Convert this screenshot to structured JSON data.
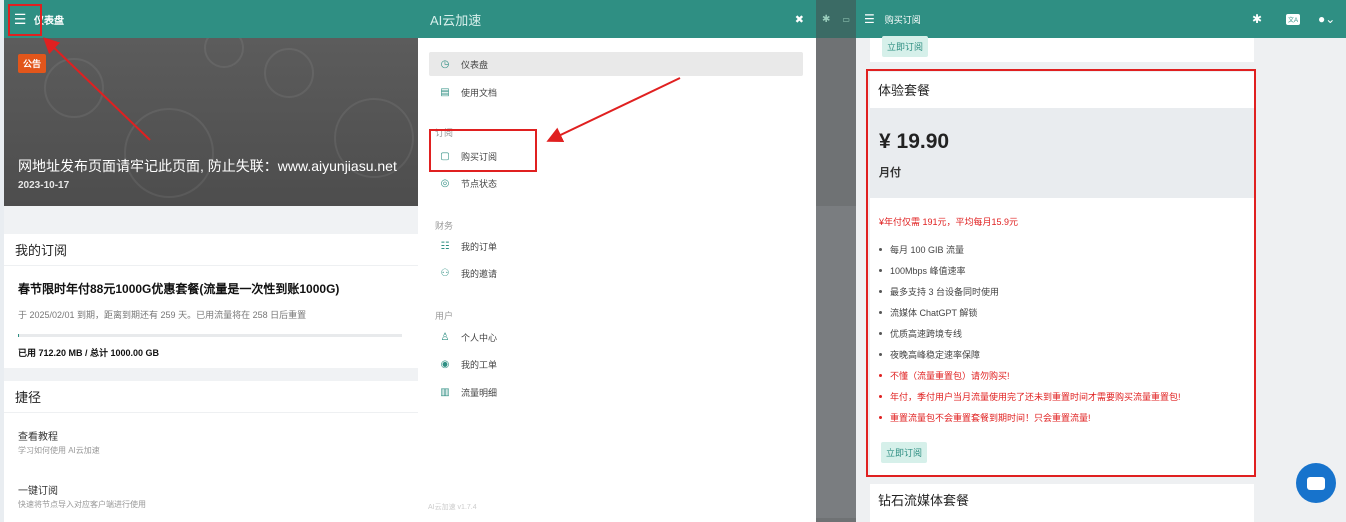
{
  "left": {
    "header_title": "仪表盘",
    "notice": {
      "badge": "公告",
      "title": "网地址发布页面请牢记此页面, 防止失联：www.aiyunjiasu.net",
      "date": "2023-10-17"
    },
    "subscription": {
      "header": "我的订阅",
      "plan_name": "春节限时年付88元1000G优惠套餐(流量是一次性到账1000G)",
      "expire_info": "于 2025/02/01 到期，距离到期还有 259 天。已用流量将在 258 日后重置",
      "usage": "已用 712.20 MB / 总计 1000.00 GB",
      "usage_fraction": 0.0007
    },
    "shortcuts": {
      "header": "捷径",
      "items": [
        {
          "title": "查看教程",
          "desc": "学习如何使用 AI云加速"
        },
        {
          "title": "一键订阅",
          "desc": "快速将节点导入对应客户端进行使用"
        }
      ]
    }
  },
  "drawer": {
    "title": "AI云加速",
    "close_icon": "close-icon",
    "items": [
      {
        "label": "仪表盘",
        "icon": "dashboard-icon"
      },
      {
        "label": "使用文档",
        "icon": "book-icon"
      }
    ],
    "groups": [
      {
        "name": "订阅",
        "items": [
          {
            "label": "购买订阅",
            "icon": "bag-icon"
          },
          {
            "label": "节点状态",
            "icon": "check-circle-icon"
          }
        ]
      },
      {
        "name": "财务",
        "items": [
          {
            "label": "我的订单",
            "icon": "list-icon"
          },
          {
            "label": "我的邀请",
            "icon": "users-icon"
          }
        ]
      },
      {
        "name": "用户",
        "items": [
          {
            "label": "个人中心",
            "icon": "user-icon"
          },
          {
            "label": "我的工单",
            "icon": "ticket-icon"
          },
          {
            "label": "流量明细",
            "icon": "chart-icon"
          }
        ]
      }
    ],
    "version": "AI云加速 v1.7.4"
  },
  "right": {
    "header_title": "购买订阅",
    "lang_label": "文A",
    "top_button": "立即订阅",
    "plan": {
      "name": "体验套餐",
      "price": "¥ 19.90",
      "period": "月付",
      "promo": "¥年付仅需 191元，平均每月15.9元",
      "features": [
        {
          "text": "每月 100 GIB 流量",
          "red": false
        },
        {
          "text": "100Mbps 峰值速率",
          "red": false
        },
        {
          "text": "最多支持 3 台设备同时使用",
          "red": false
        },
        {
          "text": "流媒体 ChatGPT 解锁",
          "red": false
        },
        {
          "text": "优质高速跨境专线",
          "red": false
        },
        {
          "text": "夜晚高峰稳定速率保障",
          "red": false
        },
        {
          "text": "不懂（流量重置包）请勿购买!",
          "red": true
        },
        {
          "text": "年付，季付用户当月流量使用完了还未到重置时间才需要购买流量重置包!",
          "red": true
        },
        {
          "text": "重置流量包不会重置套餐到期时间！只会重置流量!",
          "red": true
        }
      ],
      "button": "立即订阅"
    },
    "next_plan": "钻石流媒体套餐"
  },
  "colors": {
    "primary": "#2f8f83",
    "highlight": "#e02020",
    "notice_badge": "#e2561b"
  }
}
